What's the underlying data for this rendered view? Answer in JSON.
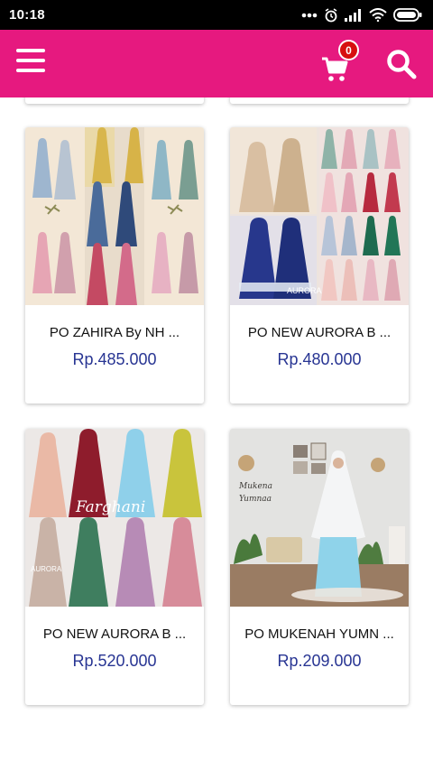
{
  "status_bar": {
    "time": "10:18"
  },
  "app_bar": {
    "cart_count": "0"
  },
  "products": [
    {
      "name": "PO ZAHIRA By NH ...",
      "price": "Rp.485.000"
    },
    {
      "name": "PO NEW AURORA B ...",
      "price": "Rp.480.000"
    },
    {
      "name": "PO NEW AURORA B ...",
      "price": "Rp.520.000"
    },
    {
      "name": "PO MUKENAH YUMN ...",
      "price": "Rp.209.000"
    }
  ],
  "image_captions": {
    "aurora_brand": "AURORA",
    "farghani_script": "Farghani",
    "mukena_title": "Mukena",
    "yumnaa_title": "Yumnaa"
  },
  "colors": {
    "app_bar": "#e6197f",
    "price": "#283593",
    "badge": "#d70f0f"
  }
}
